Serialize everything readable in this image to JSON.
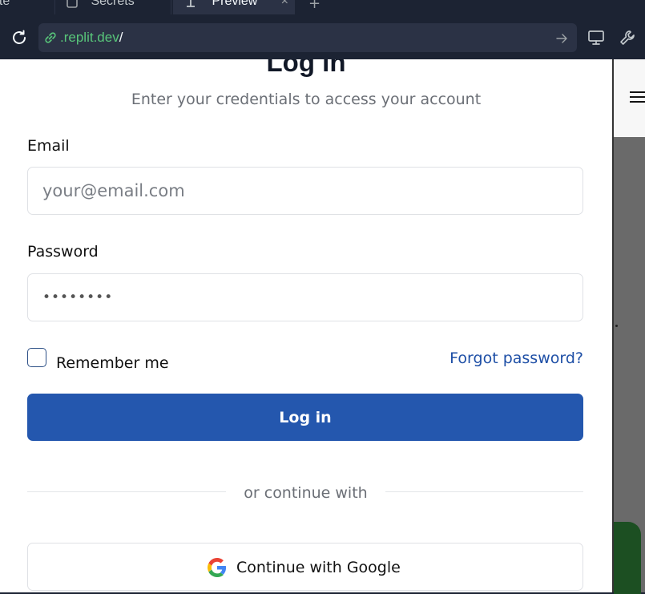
{
  "tabs": [
    {
      "label": "ote"
    },
    {
      "label": "Secrets"
    },
    {
      "label": "Preview"
    }
  ],
  "address_bar": {
    "domain": ".replit.dev",
    "path": "/"
  },
  "login": {
    "title": "Log in",
    "subtitle": "Enter your credentials to access your account",
    "email_label": "Email",
    "email_placeholder": "your@email.com",
    "password_label": "Password",
    "password_value": "••••••••",
    "remember_label": "Remember me",
    "remember_checked": false,
    "forgot_label": "Forgot password?",
    "submit_label": "Log in",
    "separator_text": "or continue with",
    "google_label": "Continue with Google"
  },
  "colors": {
    "primary_button": "#2457ae",
    "link": "#1e4fa6",
    "url_domain": "#58c67a",
    "chrome_background": "#1c2333"
  },
  "icons": [
    "reload-icon",
    "link-icon",
    "go-arrow-icon",
    "devices-icon",
    "tools-icon",
    "google-icon",
    "hamburger-icon"
  ]
}
